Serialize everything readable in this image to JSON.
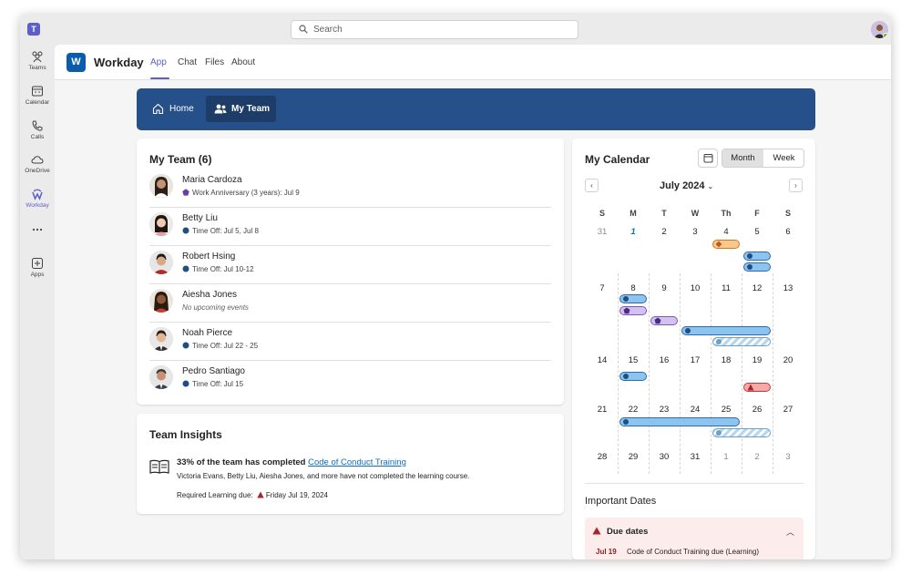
{
  "topbar": {
    "search_placeholder": "Search"
  },
  "rail": {
    "items": [
      {
        "label": "Teams",
        "icon": "teams-icon"
      },
      {
        "label": "Calendar",
        "icon": "calendar-icon"
      },
      {
        "label": "Calls",
        "icon": "phone-icon"
      },
      {
        "label": "OneDrive",
        "icon": "cloud-icon"
      },
      {
        "label": "Workday",
        "icon": "workday-icon"
      },
      {
        "label": "",
        "icon": "more-icon"
      },
      {
        "label": "Apps",
        "icon": "add-apps-icon"
      }
    ]
  },
  "app": {
    "title": "Workday",
    "logo_letter": "W",
    "tabs": [
      "App",
      "Chat",
      "Files",
      "About"
    ]
  },
  "nav": {
    "home": "Home",
    "my_team": "My Team"
  },
  "team": {
    "title": "My Team (6)",
    "members": [
      {
        "name": "Maria Cardoza",
        "event": "Work Anniversary (3 years): Jul 9",
        "type": "anniversary"
      },
      {
        "name": "Betty Liu",
        "event": "Time Off: Jul 5, Jul 8",
        "type": "timeoff"
      },
      {
        "name": "Robert Hsing",
        "event": "Time Off: Jul 10-12",
        "type": "timeoff"
      },
      {
        "name": "Aiesha Jones",
        "event": "No upcoming events",
        "type": "none"
      },
      {
        "name": "Noah Pierce",
        "event": "Time Off: Jul 22 - 25",
        "type": "timeoff"
      },
      {
        "name": "Pedro Santiago",
        "event": "Time Off: Jul 15",
        "type": "timeoff"
      }
    ]
  },
  "insights": {
    "title": "Team Insights",
    "headline_prefix": "33% of the team has completed",
    "course_link": "Code of Conduct Training",
    "detail": "Victoria Evans, Betty Liu, Aiesha Jones, and more have not completed the learning course.",
    "due_label": "Required Learning due:",
    "due_date": "Friday Jul 19, 2024"
  },
  "calendar": {
    "title": "My Calendar",
    "view_month": "Month",
    "view_week": "Week",
    "month_label": "July 2024",
    "prev": "‹",
    "next": "›",
    "dow": [
      "S",
      "M",
      "T",
      "W",
      "Th",
      "F",
      "S"
    ],
    "weeks": [
      [
        "31",
        "1",
        "2",
        "3",
        "4",
        "5",
        "6"
      ],
      [
        "7",
        "8",
        "9",
        "10",
        "11",
        "12",
        "13"
      ],
      [
        "14",
        "15",
        "16",
        "17",
        "18",
        "19",
        "20"
      ],
      [
        "21",
        "22",
        "23",
        "24",
        "25",
        "26",
        "27"
      ],
      [
        "28",
        "29",
        "30",
        "31",
        "1",
        "2",
        "3"
      ]
    ]
  },
  "important": {
    "title": "Important Dates",
    "due_title": "Due dates",
    "item_date": "Jul 19",
    "item_text": "Code of Conduct Training due (Learning)"
  },
  "colors": {
    "teams_purple": "#5b5fc7",
    "workday_blue": "#0b5cad",
    "nav_blue": "#26508a",
    "event_blue": "#8dc3ef",
    "event_orange": "#f8c98a",
    "event_purple": "#d3c1f0",
    "event_red": "#f5a9a9"
  }
}
